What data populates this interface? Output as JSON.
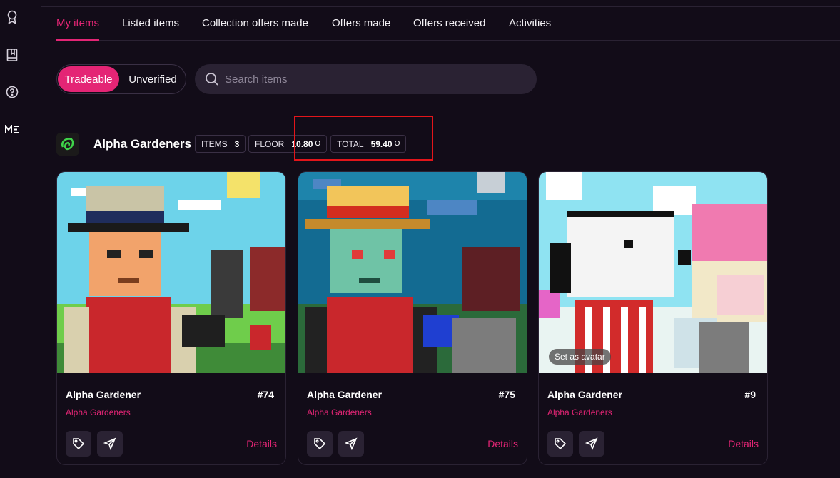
{
  "sidebar": {
    "icons": [
      "award-icon",
      "book-icon",
      "help-circle-icon",
      "magic-eden-logo-icon"
    ]
  },
  "tabs": [
    {
      "label": "My items",
      "active": true
    },
    {
      "label": "Listed items"
    },
    {
      "label": "Collection offers made"
    },
    {
      "label": "Offers made"
    },
    {
      "label": "Offers received"
    },
    {
      "label": "Activities"
    }
  ],
  "filter": {
    "tradeable": "Tradeable",
    "unverified": "Unverified"
  },
  "search": {
    "placeholder": "Search items"
  },
  "collection": {
    "name": "Alpha Gardeners",
    "items_label": "ITEMS",
    "items_value": "3",
    "floor_label": "FLOOR",
    "floor_value": "10.80",
    "total_label": "TOTAL",
    "total_value": "59.40",
    "currency_symbol": "Θ"
  },
  "cards": [
    {
      "name": "Alpha Gardener",
      "number": "#74",
      "collection": "Alpha Gardeners",
      "details": "Details"
    },
    {
      "name": "Alpha Gardener",
      "number": "#75",
      "collection": "Alpha Gardeners",
      "details": "Details"
    },
    {
      "name": "Alpha Gardener",
      "number": "#9",
      "collection": "Alpha Gardeners",
      "details": "Details",
      "overlay": "Set as avatar"
    }
  ],
  "colors": {
    "accent": "#e42575",
    "background": "#120c18",
    "surface": "#2a2233"
  }
}
